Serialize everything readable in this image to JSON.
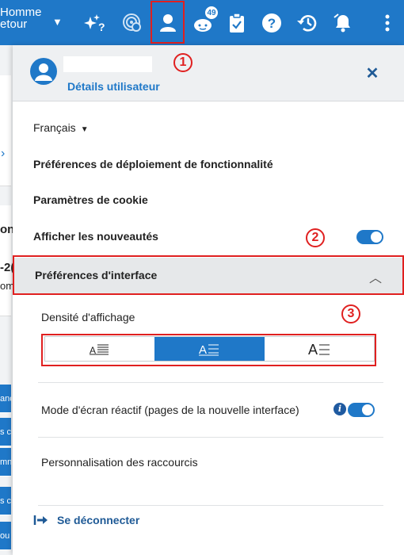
{
  "topbar": {
    "title_line1": "Homme",
    "title_line2": "etour",
    "notifications_count": "49",
    "bg_color": "#1f78c8"
  },
  "background": {
    "texts": [
      "ons",
      "-2(",
      "om"
    ],
    "buttons": [
      "anc",
      "s c",
      "mn",
      "s c",
      "ou"
    ]
  },
  "panel": {
    "user_details_link": "Détails utilisateur",
    "close_label": "✕",
    "language": "Français",
    "feature_prefs": "Préférences de déploiement de fonctionnalité",
    "cookie_settings": "Paramètres de cookie",
    "show_news": "Afficher les nouveautés",
    "interface_prefs": "Préférences d'interface",
    "display_density": "Densité d'affichage",
    "density_options": [
      "compact",
      "normal",
      "comfortable"
    ],
    "density_selected": "normal",
    "responsive_mode": "Mode d'écran réactif (pages de la nouvelle interface)",
    "shortcuts": "Personnalisation des raccourcis",
    "logout": "Se déconnecter"
  },
  "annotations": [
    "1",
    "2",
    "3"
  ]
}
